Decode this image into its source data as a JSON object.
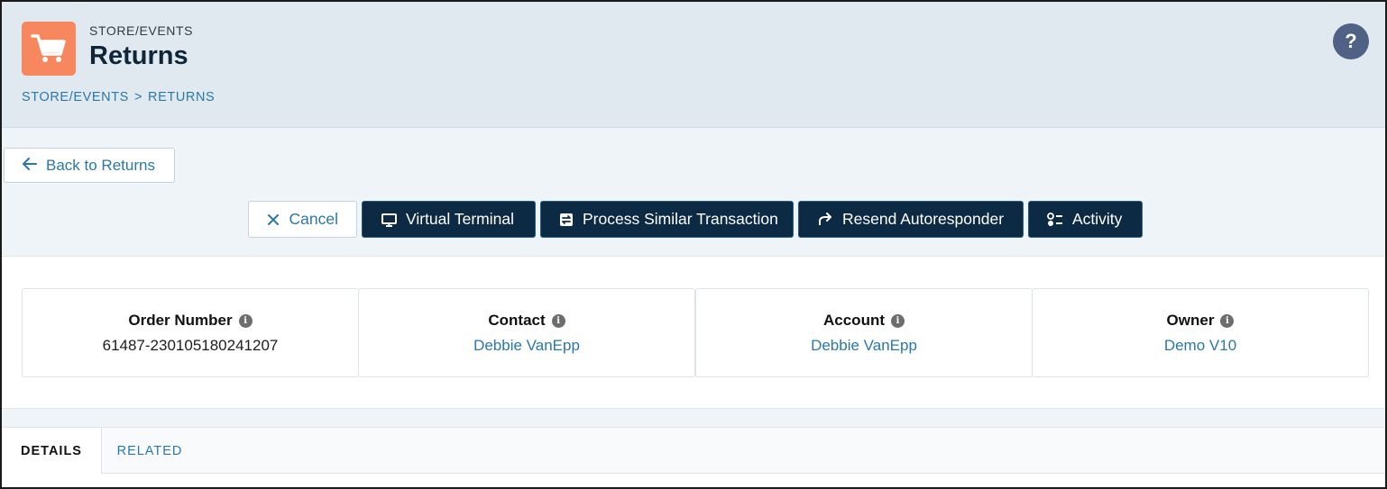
{
  "header": {
    "section_label": "STORE/EVENTS",
    "title": "Returns",
    "breadcrumb": [
      "STORE/EVENTS",
      ">",
      "RETURNS"
    ],
    "app_icon": "cart-icon",
    "help_label": "?"
  },
  "actions": {
    "back_label": "Back to Returns",
    "toolbar": [
      {
        "label": "Cancel",
        "icon": "close-icon"
      },
      {
        "label": "Virtual Terminal",
        "icon": "monitor-icon"
      },
      {
        "label": "Process Similar Transaction",
        "icon": "transaction-icon"
      },
      {
        "label": "Resend Autoresponder",
        "icon": "redo-icon"
      },
      {
        "label": "Activity",
        "icon": "activity-icon"
      }
    ]
  },
  "cards": [
    {
      "label": "Order Number",
      "value": "61487-230105180241207"
    },
    {
      "label": "Contact",
      "value": "Debbie VanEpp"
    },
    {
      "label": "Account",
      "value": "Debbie VanEpp"
    },
    {
      "label": "Owner",
      "value": "Demo V10"
    }
  ],
  "tabs": [
    "DETAILS",
    "RELATED"
  ],
  "colors": {
    "accent": "#2a78a8",
    "dark_button": "#0c2a44",
    "app_icon": "#f6875e",
    "header_bg": "#e1e9f0"
  }
}
